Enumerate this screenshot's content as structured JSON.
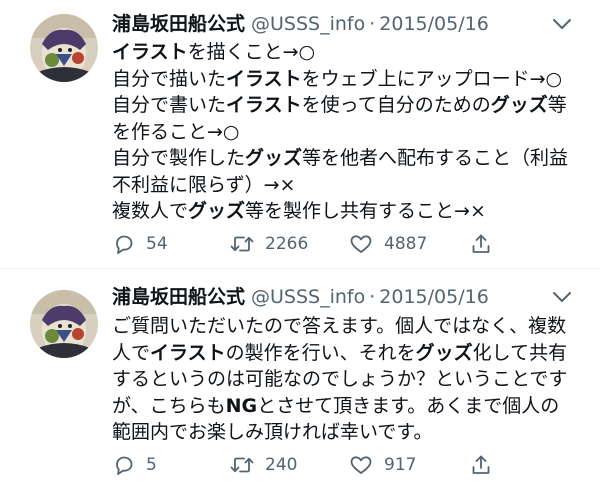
{
  "tweets": [
    {
      "display_name": "浦島坂田船公式",
      "handle": "@USSS_info",
      "separator": "·",
      "date": "2015/05/16",
      "avatar_icon": "avatar-illustration",
      "lines": [
        [
          {
            "t": "イラスト",
            "b": true
          },
          {
            "t": "を描くこと→○",
            "b": false
          }
        ],
        [
          {
            "t": "自分で描いた",
            "b": false
          },
          {
            "t": "イラスト",
            "b": true
          },
          {
            "t": "をウェブ上にアップロード→○",
            "b": false
          }
        ],
        [
          {
            "t": "自分で書いた",
            "b": false
          },
          {
            "t": "イラスト",
            "b": true
          },
          {
            "t": "を使って自分のための",
            "b": false
          },
          {
            "t": "グッズ",
            "b": true
          },
          {
            "t": "等",
            "b": false
          }
        ],
        [
          {
            "t": "を作ること→○",
            "b": false
          }
        ],
        [
          {
            "t": "自分で製作した",
            "b": false
          },
          {
            "t": "グッズ",
            "b": true
          },
          {
            "t": "等を他者へ配布すること（利益",
            "b": false
          }
        ],
        [
          {
            "t": "不利益に限らず）→×",
            "b": false
          }
        ],
        [
          {
            "t": "複数人で",
            "b": false
          },
          {
            "t": "グッズ",
            "b": true
          },
          {
            "t": "等を製作し共有すること→×",
            "b": false
          }
        ]
      ],
      "actions": {
        "reply": {
          "icon": "reply-icon",
          "count": "54"
        },
        "retweet": {
          "icon": "retweet-icon",
          "count": "2266"
        },
        "like": {
          "icon": "heart-icon",
          "count": "4887"
        },
        "share": {
          "icon": "share-icon"
        }
      }
    },
    {
      "display_name": "浦島坂田船公式",
      "handle": "@USSS_info",
      "separator": "·",
      "date": "2015/05/16",
      "avatar_icon": "avatar-illustration",
      "lines": [
        [
          {
            "t": "ご質問いただいたので答えます。個人ではなく、複数",
            "b": false
          }
        ],
        [
          {
            "t": "人で",
            "b": false
          },
          {
            "t": "イラスト",
            "b": true
          },
          {
            "t": "の製作を行い、それを",
            "b": false
          },
          {
            "t": "グッズ",
            "b": true
          },
          {
            "t": "化して共有",
            "b": false
          }
        ],
        [
          {
            "t": "するというのは可能なのでしょうか？ということです",
            "b": false
          }
        ],
        [
          {
            "t": "が、こちらも",
            "b": false
          },
          {
            "t": "NG",
            "b": true
          },
          {
            "t": "とさせて頂きます。あくまで個人の",
            "b": false
          }
        ],
        [
          {
            "t": "範囲内でお楽しみ頂ければ幸いです。",
            "b": false
          }
        ]
      ],
      "actions": {
        "reply": {
          "icon": "reply-icon",
          "count": "5"
        },
        "retweet": {
          "icon": "retweet-icon",
          "count": "240"
        },
        "like": {
          "icon": "heart-icon",
          "count": "917"
        },
        "share": {
          "icon": "share-icon"
        }
      }
    }
  ]
}
